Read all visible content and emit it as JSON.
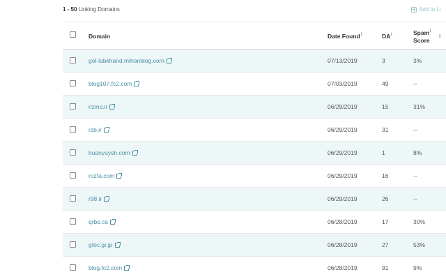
{
  "header": {
    "range_label": "1 - 50",
    "range_suffix": " Linking Domains",
    "add_to_list_label": "Add to Li"
  },
  "table": {
    "columns": {
      "domain": "Domain",
      "date_found": "Date Found",
      "da": "DA",
      "spam_line1": "Spam",
      "spam_line2": "Score",
      "info_mark": "i"
    },
    "rows": [
      {
        "domain": "gol-labkhand.mihanblog.com",
        "date": "07/13/2019",
        "da": "3",
        "spam": "3%"
      },
      {
        "domain": "blog107.fc2.com",
        "date": "07/03/2019",
        "da": "49",
        "spam": "--"
      },
      {
        "domain": "rizino.ir",
        "date": "06/29/2019",
        "da": "15",
        "spam": "31%"
      },
      {
        "domain": "rzb.ir",
        "date": "06/29/2019",
        "da": "31",
        "spam": "--"
      },
      {
        "domain": "huanyuysh.com",
        "date": "06/29/2019",
        "da": "1",
        "spam": "8%"
      },
      {
        "domain": "rozfa.com",
        "date": "06/29/2019",
        "da": "16",
        "spam": "--"
      },
      {
        "domain": "r98.ir",
        "date": "06/29/2019",
        "da": "26",
        "spam": "--"
      },
      {
        "domain": "qrbs.ca",
        "date": "06/28/2019",
        "da": "17",
        "spam": "30%"
      },
      {
        "domain": "gfoc.gr.jp",
        "date": "06/28/2019",
        "da": "27",
        "spam": "53%"
      },
      {
        "domain": "blog.fc2.com",
        "date": "06/28/2019",
        "da": "91",
        "spam": "9%"
      }
    ]
  },
  "colors": {
    "link": "#4a90a4",
    "row_alt_bg": "#eef7f7",
    "add_to_list": "#9bc5c8"
  },
  "icons": {
    "external_link": "external-link-icon",
    "add": "plus-icon",
    "info": "info-icon"
  }
}
